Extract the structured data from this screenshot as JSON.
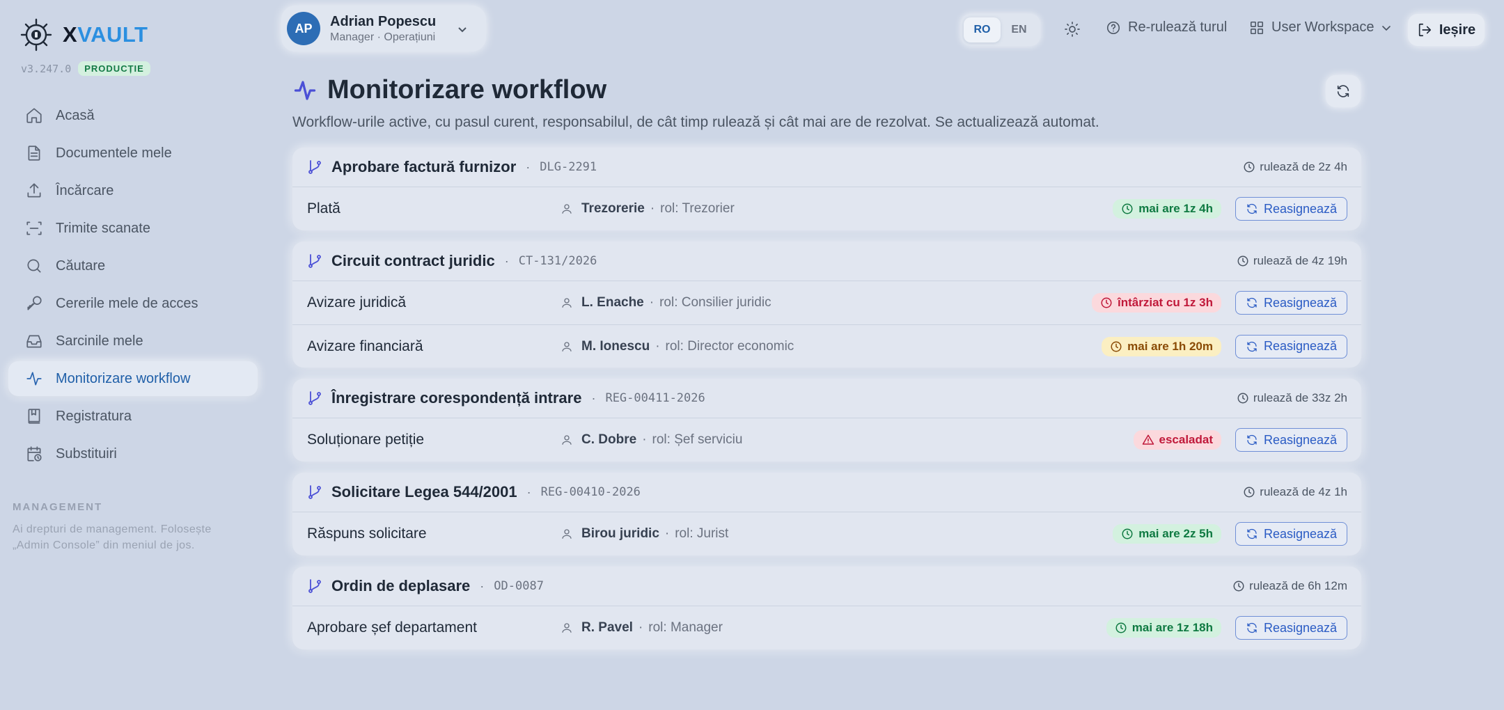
{
  "brand": {
    "x": "X",
    "vault": "VAULT",
    "version": "v3.247.0",
    "env": "PRODUCȚIE"
  },
  "sidebar": {
    "items": [
      {
        "label": "Acasă",
        "icon": "home-icon"
      },
      {
        "label": "Documentele mele",
        "icon": "document-icon"
      },
      {
        "label": "Încărcare",
        "icon": "upload-icon"
      },
      {
        "label": "Trimite scanate",
        "icon": "scan-icon"
      },
      {
        "label": "Căutare",
        "icon": "search-icon"
      },
      {
        "label": "Cererile mele de acces",
        "icon": "key-icon"
      },
      {
        "label": "Sarcinile mele",
        "icon": "inbox-icon"
      },
      {
        "label": "Monitorizare workflow",
        "icon": "activity-icon",
        "active": true
      },
      {
        "label": "Registratura",
        "icon": "book-icon"
      },
      {
        "label": "Substituiri",
        "icon": "calendar-clock-icon"
      }
    ],
    "management": {
      "title": "MANAGEMENT",
      "note": "Ai drepturi de management. Folosește „Admin Console” din meniul de jos."
    }
  },
  "topbar": {
    "user": {
      "initials": "AP",
      "name": "Adrian Popescu",
      "role": "Manager · Operațiuni"
    },
    "lang": {
      "ro": "RO",
      "en": "EN",
      "selected": "RO"
    },
    "tour": "Re-rulează turul",
    "workspace": "User Workspace",
    "logout": "Ieșire"
  },
  "page": {
    "title": "Monitorizare workflow",
    "subtitle": "Workflow-urile active, cu pasul curent, responsabilul, de cât timp rulează și cât mai are de rezolvat. Se actualizează automat."
  },
  "labels": {
    "role_prefix": "rol:",
    "reassign": "Reasignează",
    "dot": "·"
  },
  "colors": {
    "accent": "#4b50d6",
    "primary": "#2a5bc4",
    "ok": "#0f7a42",
    "late": "#c0193a",
    "warn": "#8a4b06"
  },
  "workflows": [
    {
      "title": "Aprobare factură furnizor",
      "code": "DLG-2291",
      "running": "rulează de 2z 4h",
      "steps": [
        {
          "name": "Plată",
          "who": "Trezorerie",
          "role": "rol: Trezorier",
          "status": "mai are 1z 4h",
          "kind": "ok"
        }
      ]
    },
    {
      "title": "Circuit contract juridic",
      "code": "CT-131/2026",
      "running": "rulează de 4z 19h",
      "steps": [
        {
          "name": "Avizare juridică",
          "who": "L. Enache",
          "role": "rol: Consilier juridic",
          "status": "întârziat cu 1z 3h",
          "kind": "late"
        },
        {
          "name": "Avizare financiară",
          "who": "M. Ionescu",
          "role": "rol: Director economic",
          "status": "mai are 1h 20m",
          "kind": "warn"
        }
      ]
    },
    {
      "title": "Înregistrare corespondență intrare",
      "code": "REG-00411-2026",
      "running": "rulează de 33z 2h",
      "steps": [
        {
          "name": "Soluționare petiție",
          "who": "C. Dobre",
          "role": "rol: Șef serviciu",
          "status": "escaladat",
          "kind": "escalated"
        }
      ]
    },
    {
      "title": "Solicitare Legea 544/2001",
      "code": "REG-00410-2026",
      "running": "rulează de 4z 1h",
      "steps": [
        {
          "name": "Răspuns solicitare",
          "who": "Birou juridic",
          "role": "rol: Jurist",
          "status": "mai are 2z 5h",
          "kind": "ok"
        }
      ]
    },
    {
      "title": "Ordin de deplasare",
      "code": "OD-0087",
      "running": "rulează de 6h 12m",
      "steps": [
        {
          "name": "Aprobare șef departament",
          "who": "R. Pavel",
          "role": "rol: Manager",
          "status": "mai are 1z 18h",
          "kind": "ok"
        }
      ]
    }
  ]
}
